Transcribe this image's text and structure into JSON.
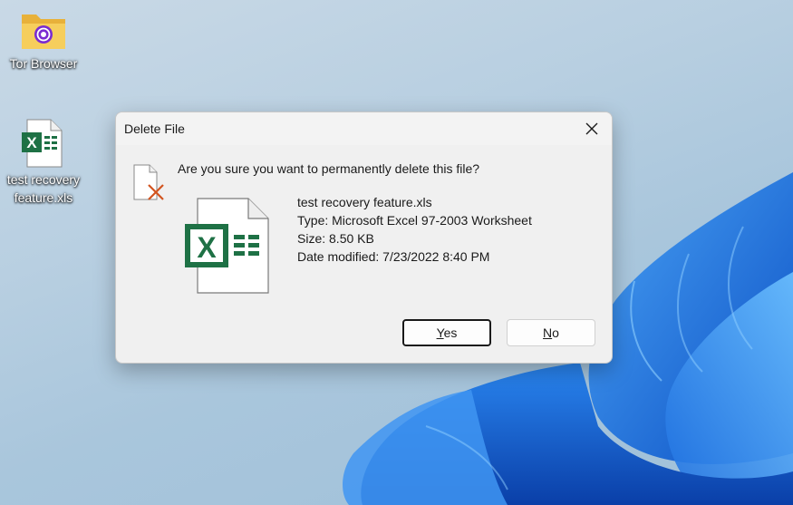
{
  "desktop": {
    "icons": [
      {
        "label": "Tor Browser",
        "icon": "folder-tor-icon"
      },
      {
        "label": "test recovery\nfeature.xls",
        "icon": "excel-file-icon"
      }
    ]
  },
  "dialog": {
    "title": "Delete File",
    "question": "Are you sure you want to permanently delete this file?",
    "file": {
      "name": "test recovery feature.xls",
      "type": "Type: Microsoft Excel 97-2003 Worksheet",
      "size": "Size: 8.50 KB",
      "modified": "Date modified: 7/23/2022 8:40 PM"
    },
    "buttons": {
      "yes_label": "Yes",
      "yes_accel": "Y",
      "yes_rest": "es",
      "no_label": "No",
      "no_accel": "N",
      "no_rest": "o"
    }
  },
  "colors": {
    "excel_green": "#1e7145",
    "delete_x": "#d2541f",
    "wallpaper_blue": "#1a73e8"
  }
}
